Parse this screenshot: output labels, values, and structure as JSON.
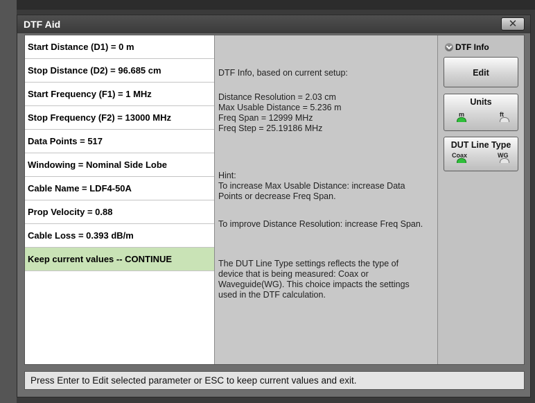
{
  "window": {
    "title": "DTF Aid",
    "close_label": "✕"
  },
  "parameters": [
    {
      "label": "Start Distance (D1) = 0 m"
    },
    {
      "label": "Stop Distance (D2) = 96.685 cm"
    },
    {
      "label": "Start Frequency (F1) = 1 MHz"
    },
    {
      "label": "Stop Frequency (F2) = 13000 MHz"
    },
    {
      "label": "Data Points = 517"
    },
    {
      "label": "Windowing = Nominal Side Lobe"
    },
    {
      "label": "Cable Name = LDF4-50A"
    },
    {
      "label": "Prop Velocity = 0.88"
    },
    {
      "label": "Cable Loss = 0.393 dB/m"
    },
    {
      "label": "Keep current values -- CONTINUE",
      "highlighted": true,
      "highlight_color": "#c9e3b6"
    }
  ],
  "info": {
    "heading": "DTF Info, based on current setup:",
    "lines": [
      "Distance Resolution = 2.03 cm",
      "Max Usable Distance = 5.236 m",
      "Freq Span = 12999 MHz",
      "Freq Step = 25.19186 MHz"
    ],
    "hint_title": "Hint:",
    "hint_1": "To increase Max Usable Distance: increase Data Points or decrease Freq Span.",
    "hint_2": "To improve Distance Resolution: increase Freq Span.",
    "hint_3": "The DUT Line Type settings reflects the type of device that is being measured: Coax or Waveguide(WG). This choice impacts the settings used in the DTF calculation."
  },
  "side_panel": {
    "section_label": "DTF Info",
    "edit_button": "Edit",
    "units": {
      "label": "Units",
      "options": [
        "m",
        "ft"
      ],
      "selected": "m"
    },
    "dut_line_type": {
      "label": "DUT Line Type",
      "options": [
        "Coax",
        "WG"
      ],
      "selected": "Coax"
    },
    "led_on_color": "#2fbf3a"
  },
  "status_bar": {
    "text": "Press Enter to Edit selected parameter or ESC to keep current values and exit."
  }
}
